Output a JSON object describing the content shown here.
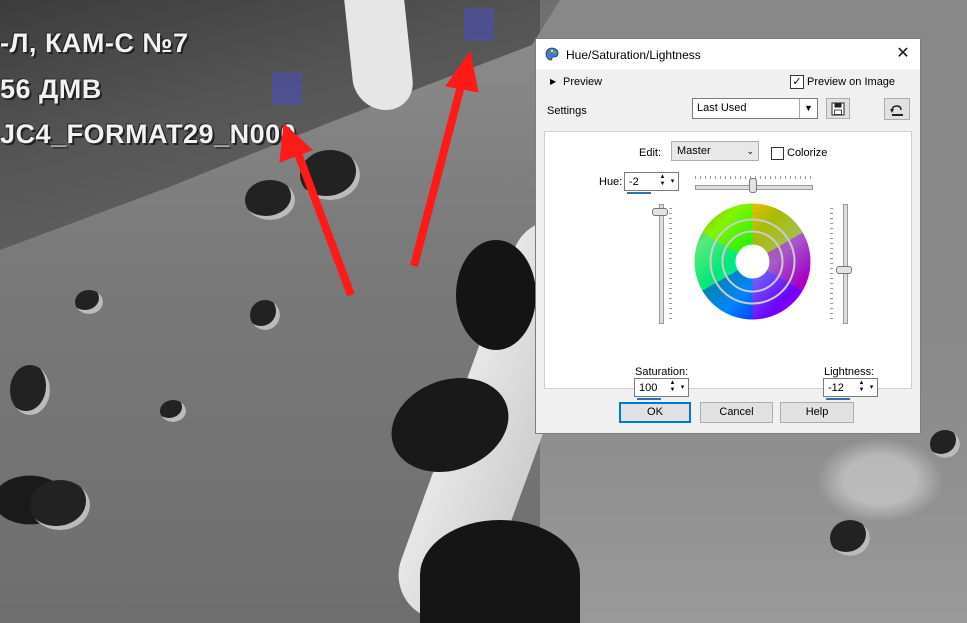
{
  "background": {
    "overlay_lines": [
      "-Л, КАМ-С №7",
      "56 ДМВ",
      "JC4_FORMAT29_N000"
    ],
    "arrow_color": "#ff1a1a",
    "marker_color": "#4d4f9a"
  },
  "dialog": {
    "title": "Hue/Saturation/Lightness",
    "close_glyph": "✕",
    "preview_label": "Preview",
    "preview_on_image_label": "Preview on Image",
    "preview_on_image_checked": true,
    "settings_label": "Settings",
    "settings_value": "Last Used",
    "edit_label": "Edit:",
    "edit_value": "Master",
    "colorize_label": "Colorize",
    "colorize_checked": false,
    "hue_label": "Hue:",
    "hue_value": "-2",
    "saturation_label": "Saturation:",
    "saturation_value": "100",
    "lightness_label": "Lightness:",
    "lightness_value": "-12",
    "buttons": {
      "ok": "OK",
      "cancel": "Cancel",
      "help": "Help"
    },
    "icons": {
      "title": "paint-palette-icon",
      "save": "save-disk-icon",
      "reset": "reset-undo-icon"
    }
  }
}
